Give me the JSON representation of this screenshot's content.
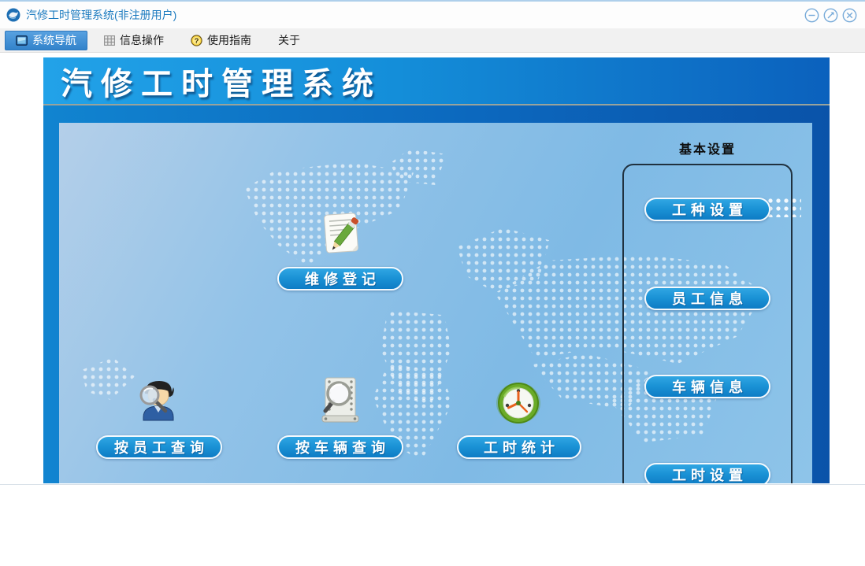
{
  "window": {
    "title": "汽修工时管理系统(非注册用户)",
    "app_icon": "app-logo-icon",
    "controls": [
      {
        "name": "minimize-button",
        "icon": "minimize-icon"
      },
      {
        "name": "maximize-button",
        "icon": "maximize-icon"
      },
      {
        "name": "close-button",
        "icon": "close-icon"
      }
    ]
  },
  "menubar": {
    "items": [
      {
        "label": "系统导航",
        "icon": "monitor-icon",
        "active": true
      },
      {
        "label": "信息操作",
        "icon": "grid-icon",
        "active": false
      },
      {
        "label": "使用指南",
        "icon": "help-icon",
        "active": false
      },
      {
        "label": "关于",
        "icon": "",
        "active": false
      }
    ]
  },
  "banner": {
    "title": "汽修工时管理系统"
  },
  "main_buttons": [
    {
      "label": "维修登记",
      "icon": "notepad-pencil-icon"
    },
    {
      "label": "按员工查询",
      "icon": "employee-search-icon"
    },
    {
      "label": "按车辆查询",
      "icon": "vehicle-search-icon"
    },
    {
      "label": "工时统计",
      "icon": "clock-icon"
    }
  ],
  "settings_panel": {
    "title": "基本设置",
    "buttons": [
      {
        "label": "工种设置"
      },
      {
        "label": "员工信息"
      },
      {
        "label": "车辆信息"
      },
      {
        "label": "工时设置"
      }
    ]
  },
  "colors": {
    "banner_gradient_start": "#22a2e8",
    "banner_gradient_end": "#0b61bd",
    "frame_blue": "#0c68be",
    "panel_light_blue": "#8ec0e7",
    "button_blue_top": "#31a6e3",
    "button_blue_bottom": "#0e7cc5",
    "active_tab_blue": "#3383cb",
    "title_text_blue": "#1b7abf"
  }
}
